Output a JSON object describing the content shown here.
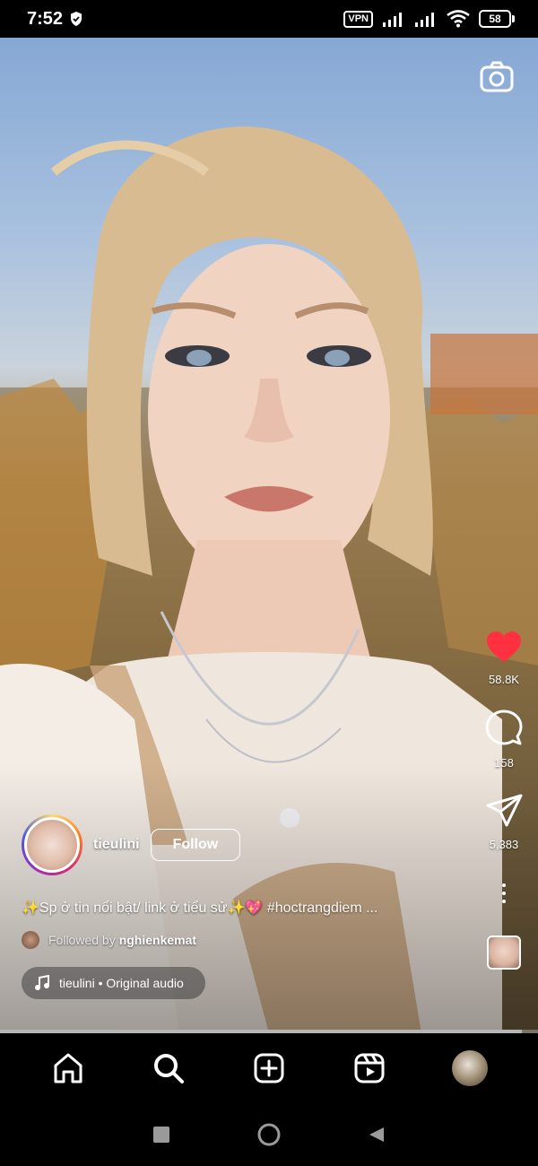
{
  "status_bar": {
    "time": "7:52",
    "vpn": "VPN",
    "battery": "58"
  },
  "reel": {
    "likes": "58.8K",
    "comments": "158",
    "shares": "5,383",
    "progress_fraction": 0.97
  },
  "creator": {
    "username": "tieulini",
    "follow_label": "Follow"
  },
  "caption": {
    "text": "✨Sp ở tin nổi bật/ link ở tiểu sử✨💖",
    "hashtag": "#hoctrangdiem ..."
  },
  "followed_by": {
    "label": "Followed by",
    "name": "nghienkemat"
  },
  "audio": {
    "label": "tieulini • Original audio"
  },
  "colors": {
    "like_red": "#ff3040",
    "accent_white": "#ffffff"
  },
  "icons": {
    "camera": "camera-icon",
    "like": "heart-icon",
    "comment": "comment-icon",
    "share": "send-icon",
    "more": "more-icon",
    "home": "home-icon",
    "search": "search-icon",
    "create": "create-icon",
    "reels": "reels-icon"
  }
}
